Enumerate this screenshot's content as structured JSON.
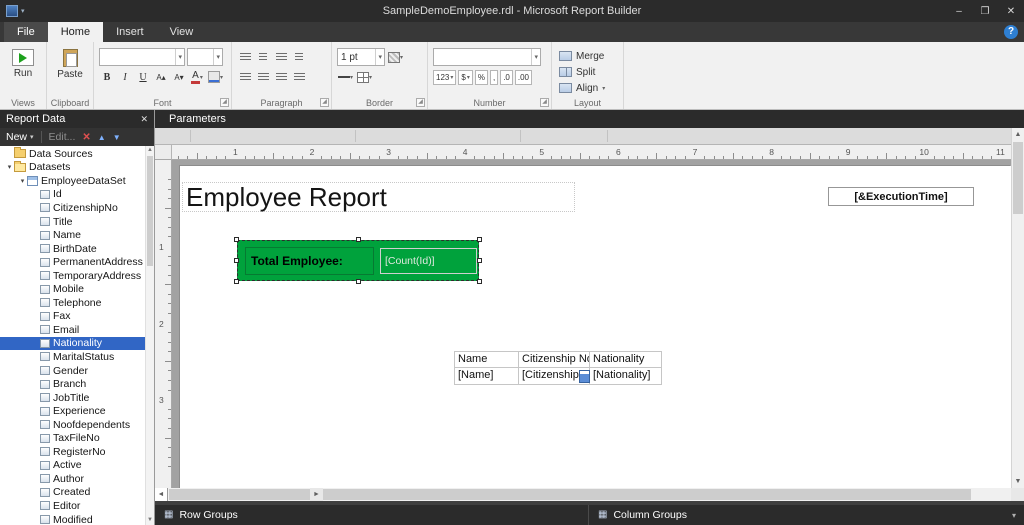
{
  "window": {
    "title": "SampleDemoEmployee.rdl - Microsoft Report Builder"
  },
  "icons": {
    "expanded": "▾",
    "caret_down": "▾",
    "close": "✕",
    "minimize": "–",
    "maximize": "❐",
    "help": "?",
    "delete_x": "✕",
    "up_arrow": "▲",
    "down_arrow": "▼",
    "scroll_up": "▲",
    "scroll_down": "▼",
    "scroll_left": "◄",
    "scroll_right": "►",
    "grid": "▦",
    "launcher": "◿"
  },
  "ribbon": {
    "tabs": [
      "File",
      "Home",
      "Insert",
      "View"
    ],
    "active_tab": "Home",
    "views": {
      "run_label": "Run",
      "group_label": "Views"
    },
    "clipboard": {
      "paste_label": "Paste",
      "group_label": "Clipboard"
    },
    "font": {
      "group_label": "Font",
      "bold": "B",
      "italic": "I",
      "underline": "U",
      "grow": "A▴",
      "shrink": "A▾",
      "color": "A"
    },
    "paragraph": {
      "group_label": "Paragraph"
    },
    "border": {
      "group_label": "Border",
      "width_value": "1 pt"
    },
    "number": {
      "group_label": "Number",
      "chips": [
        {
          "label": "123",
          "name": "number-format-button",
          "caret": true
        },
        {
          "label": "$",
          "name": "currency-button",
          "caret": true
        },
        {
          "label": "%",
          "name": "percent-button"
        },
        {
          "label": ",",
          "name": "comma-button"
        },
        {
          "label": ".0",
          "name": "decimal-decrease-button"
        },
        {
          "label": ".00",
          "name": "decimal-increase-button"
        }
      ]
    },
    "layout": {
      "group_label": "Layout",
      "buttons": [
        {
          "label": "Merge",
          "name": "merge-button",
          "icon": "merge"
        },
        {
          "label": "Split",
          "name": "split-button",
          "icon": "split"
        },
        {
          "label": "Align",
          "name": "align-button",
          "icon": "merge",
          "caret": true
        }
      ]
    }
  },
  "report_data_panel": {
    "title": "Report Data",
    "toolbar": {
      "new_label": "New",
      "edit_label": "Edit..."
    },
    "tree": [
      {
        "label": "Data Sources",
        "type": "folder",
        "indent": 0
      },
      {
        "label": "Datasets",
        "type": "folder-open",
        "indent": 0,
        "expanded": true
      },
      {
        "label": "EmployeeDataSet",
        "type": "dataset",
        "indent": 1,
        "expanded": true
      },
      {
        "label": "Id",
        "type": "field",
        "indent": 2
      },
      {
        "label": "CitizenshipNo",
        "type": "field",
        "indent": 2
      },
      {
        "label": "Title",
        "type": "field",
        "indent": 2
      },
      {
        "label": "Name",
        "type": "field",
        "indent": 2
      },
      {
        "label": "BirthDate",
        "type": "field",
        "indent": 2
      },
      {
        "label": "PermanentAddress",
        "type": "field",
        "indent": 2
      },
      {
        "label": "TemporaryAddress",
        "type": "field",
        "indent": 2
      },
      {
        "label": "Mobile",
        "type": "field",
        "indent": 2
      },
      {
        "label": "Telephone",
        "type": "field",
        "indent": 2
      },
      {
        "label": "Fax",
        "type": "field",
        "indent": 2
      },
      {
        "label": "Email",
        "type": "field",
        "indent": 2
      },
      {
        "label": "Nationality",
        "type": "field",
        "indent": 2,
        "selected": true
      },
      {
        "label": "MaritalStatus",
        "type": "field",
        "indent": 2
      },
      {
        "label": "Gender",
        "type": "field",
        "indent": 2
      },
      {
        "label": "Branch",
        "type": "field",
        "indent": 2
      },
      {
        "label": "JobTitle",
        "type": "field",
        "indent": 2
      },
      {
        "label": "Experience",
        "type": "field",
        "indent": 2
      },
      {
        "label": "Noofdependents",
        "type": "field",
        "indent": 2
      },
      {
        "label": "TaxFileNo",
        "type": "field",
        "indent": 2
      },
      {
        "label": "RegisterNo",
        "type": "field",
        "indent": 2
      },
      {
        "label": "Active",
        "type": "field",
        "indent": 2
      },
      {
        "label": "Author",
        "type": "field",
        "indent": 2
      },
      {
        "label": "Created",
        "type": "field",
        "indent": 2
      },
      {
        "label": "Editor",
        "type": "field",
        "indent": 2
      },
      {
        "label": "Modified",
        "type": "field",
        "indent": 2
      }
    ]
  },
  "parameters_bar": {
    "label": "Parameters"
  },
  "design": {
    "title_text": "Employee Report",
    "execution_time": "[&ExecutionTime]",
    "summary": {
      "label": "Total Employee:",
      "value": "[Count(Id)]"
    },
    "table": {
      "headers": [
        "Name",
        "Citizenship No",
        "Nationality"
      ],
      "row": [
        "[Name]",
        "[CitizenshipNo]",
        "[Nationality]"
      ]
    },
    "h_ruler_numbers": [
      "1",
      "2",
      "3",
      "4",
      "5",
      "6",
      "7",
      "8",
      "9",
      "10",
      "11"
    ],
    "v_ruler_numbers": [
      "1",
      "2",
      "3"
    ]
  },
  "groups_bar": {
    "row_label": "Row Groups",
    "column_label": "Column Groups"
  },
  "colors": {
    "summary_green": "#00a23c",
    "selection_blue": "#3166c5",
    "panel_dark": "#2b2b2b"
  }
}
